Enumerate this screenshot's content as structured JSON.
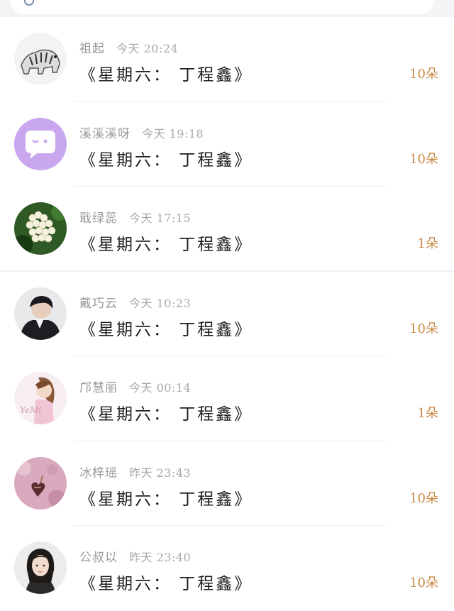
{
  "messages": [
    {
      "name": "祖起",
      "time": "今天 20:24",
      "title": "《星期六： 丁程鑫》",
      "count": "10朵",
      "avatar_icon": "tiger-avatar"
    },
    {
      "name": "溪溪溪呀",
      "time": "今天 19:18",
      "title": "《星期六： 丁程鑫》",
      "count": "10朵",
      "avatar_icon": "chat-bubble-avatar"
    },
    {
      "name": "戢绿蕊",
      "time": "今天 17:15",
      "title": "《星期六： 丁程鑫》",
      "count": "1朵",
      "avatar_icon": "flowers-avatar"
    },
    {
      "name": "戴巧云",
      "time": "今天 10:23",
      "title": "《星期六： 丁程鑫》",
      "count": "10朵",
      "avatar_icon": "person-avatar"
    },
    {
      "name": "邝慧丽",
      "time": "今天 00:14",
      "title": "《星期六： 丁程鑫》",
      "count": "1朵",
      "avatar_icon": "girl-avatar"
    },
    {
      "name": "冰梓瑶",
      "time": "昨天 23:43",
      "title": "《星期六： 丁程鑫》",
      "count": "10朵",
      "avatar_icon": "heart-charm-avatar"
    },
    {
      "name": "公叔以",
      "time": "昨天 23:40",
      "title": "《星期六： 丁程鑫》",
      "count": "10朵",
      "avatar_icon": "woman-portrait-avatar"
    }
  ],
  "colors": {
    "accent_count": "#c98a45",
    "chat_avatar_bg": "#c8a7ef"
  }
}
